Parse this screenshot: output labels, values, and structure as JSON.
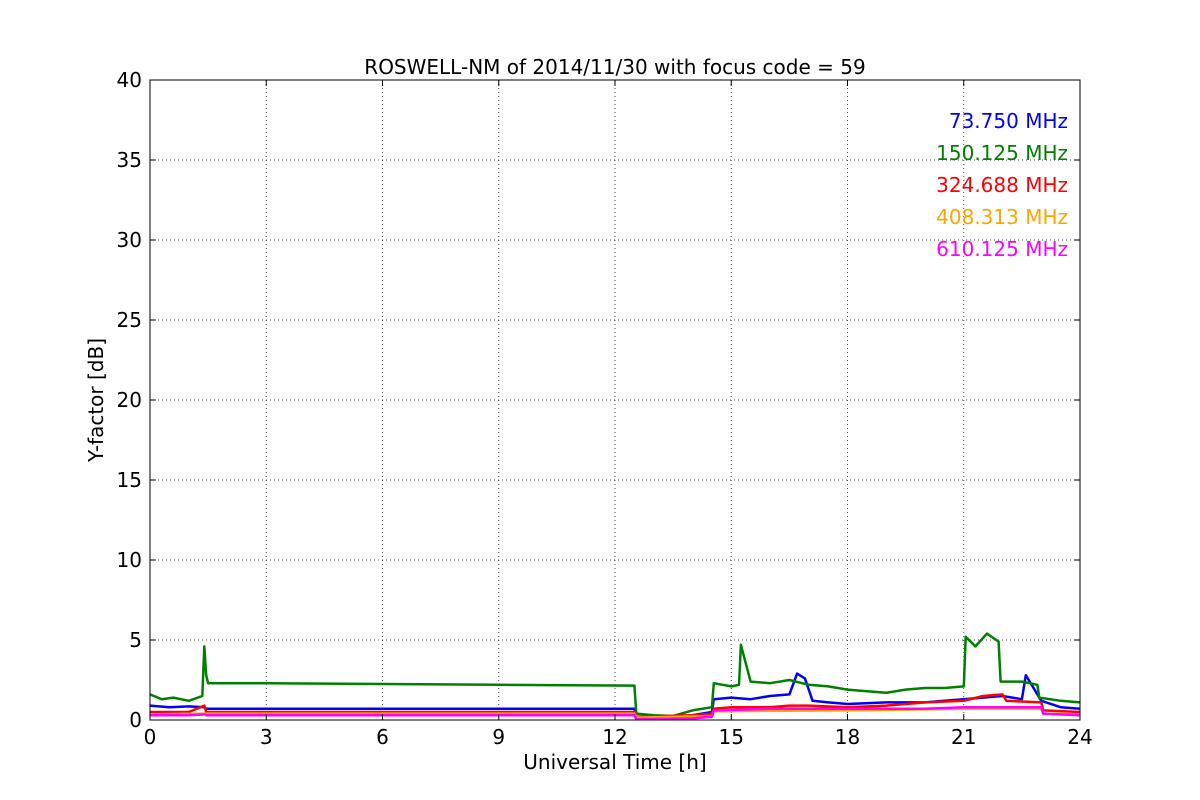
{
  "chart_data": {
    "type": "line",
    "title": "ROSWELL-NM of 2014/11/30 with focus code = 59",
    "xlabel": "Universal Time [h]",
    "ylabel": "Y-factor [dB]",
    "xlim": [
      0,
      24
    ],
    "ylim": [
      0,
      40
    ],
    "xticks": [
      0,
      3,
      6,
      9,
      12,
      15,
      18,
      21,
      24
    ],
    "yticks": [
      0,
      5,
      10,
      15,
      20,
      25,
      30,
      35,
      40
    ],
    "grid": true,
    "legend_position": "top-right",
    "series": [
      {
        "name": "73.750 MHz",
        "color": "#0000ff",
        "x": [
          0,
          0.5,
          1.0,
          1.4,
          1.45,
          3,
          6,
          9,
          12.5,
          12.55,
          13.5,
          14.0,
          14.5,
          14.55,
          15.0,
          15.5,
          16.0,
          16.5,
          16.7,
          16.9,
          17.1,
          17.5,
          18,
          19,
          20,
          20.5,
          21,
          21.5,
          22,
          22.5,
          22.6,
          23,
          23.5,
          24
        ],
        "y": [
          0.9,
          0.8,
          0.85,
          0.8,
          0.7,
          0.7,
          0.7,
          0.7,
          0.7,
          0.1,
          0.2,
          0.3,
          0.5,
          1.3,
          1.4,
          1.3,
          1.5,
          1.6,
          2.9,
          2.6,
          1.2,
          1.1,
          1.0,
          1.1,
          1.1,
          1.2,
          1.3,
          1.4,
          1.5,
          1.3,
          2.8,
          1.2,
          0.8,
          0.7
        ]
      },
      {
        "name": "150.125 MHz",
        "color": "#008000",
        "x": [
          0,
          0.3,
          0.6,
          1.0,
          1.35,
          1.4,
          1.45,
          1.5,
          3,
          6,
          9,
          12.5,
          12.55,
          13.0,
          13.5,
          14.0,
          14.5,
          14.55,
          15.0,
          15.2,
          15.25,
          15.5,
          16.0,
          16.5,
          17.0,
          17.5,
          18.0,
          18.5,
          19.0,
          19.5,
          20.0,
          20.5,
          21.0,
          21.05,
          21.3,
          21.6,
          21.9,
          21.95,
          22.5,
          22.9,
          22.95,
          23.5,
          24
        ],
        "y": [
          1.6,
          1.3,
          1.4,
          1.2,
          1.5,
          4.6,
          2.8,
          2.3,
          2.3,
          2.25,
          2.2,
          2.15,
          0.4,
          0.3,
          0.25,
          0.6,
          0.8,
          2.3,
          2.1,
          2.2,
          4.7,
          2.4,
          2.3,
          2.5,
          2.2,
          2.1,
          1.9,
          1.8,
          1.7,
          1.9,
          2.0,
          2.0,
          2.1,
          5.2,
          4.6,
          5.4,
          4.9,
          2.4,
          2.4,
          2.2,
          1.4,
          1.2,
          1.1
        ]
      },
      {
        "name": "324.688 MHz",
        "color": "#ff0000",
        "x": [
          0,
          1.0,
          1.4,
          1.45,
          3,
          6,
          9,
          12.5,
          12.55,
          14.0,
          14.5,
          14.55,
          15.0,
          16.0,
          16.5,
          17.0,
          18.0,
          19.0,
          19.5,
          20.0,
          21.0,
          21.5,
          22.0,
          22.1,
          23.0,
          23.05,
          24
        ],
        "y": [
          0.5,
          0.5,
          0.9,
          0.5,
          0.5,
          0.5,
          0.5,
          0.5,
          0.2,
          0.3,
          0.4,
          0.7,
          0.8,
          0.8,
          0.9,
          0.9,
          0.8,
          0.9,
          1.0,
          1.1,
          1.2,
          1.5,
          1.6,
          1.2,
          1.1,
          0.6,
          0.5
        ]
      },
      {
        "name": "408.313 MHz",
        "color": "#ffa500",
        "x": [
          0,
          1.4,
          1.45,
          12.5,
          12.55,
          14.5,
          14.55,
          18,
          21,
          23,
          23.05,
          24
        ],
        "y": [
          0.35,
          0.4,
          0.4,
          0.4,
          0.15,
          0.25,
          0.55,
          0.6,
          0.7,
          0.7,
          0.4,
          0.35
        ]
      },
      {
        "name": "610.125 MHz",
        "color": "#ff00ff",
        "x": [
          0,
          1.0,
          1.4,
          1.45,
          3,
          6,
          9,
          12.5,
          12.55,
          14.0,
          14.5,
          14.55,
          16.0,
          18.0,
          20.0,
          21.0,
          22.0,
          23.0,
          23.05,
          24
        ],
        "y": [
          0.3,
          0.3,
          0.35,
          0.3,
          0.3,
          0.3,
          0.3,
          0.3,
          0.05,
          0.1,
          0.2,
          0.6,
          0.7,
          0.7,
          0.7,
          0.8,
          0.8,
          0.8,
          0.4,
          0.3
        ]
      }
    ]
  }
}
